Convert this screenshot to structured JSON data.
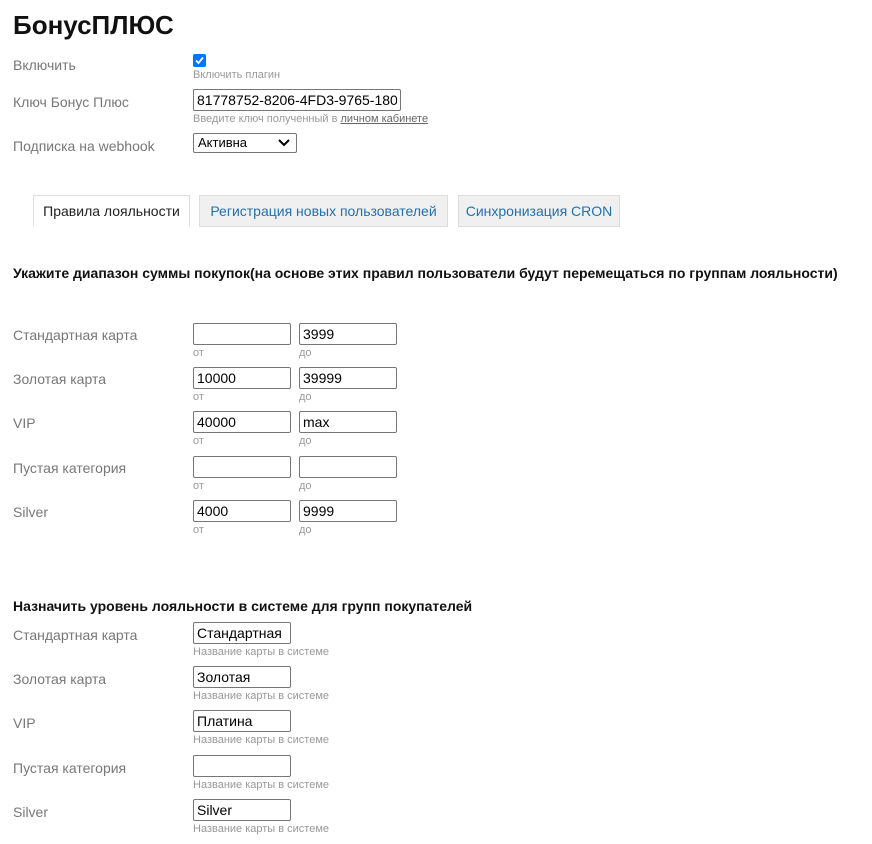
{
  "title": "БонусПЛЮС",
  "settings": {
    "enable_label": "Включить",
    "enable_hint": "Включить плагин",
    "enable_checked": true,
    "key_label": "Ключ Бонус Плюс",
    "key_value": "81778752-8206-4FD3-9765-180",
    "key_hint": "Введите ключ полученный в",
    "key_hint_link": "личном кабинете",
    "webhook_label": "Подписка на webhook",
    "webhook_value": "Активна"
  },
  "tabs": [
    {
      "label": "Правила лояльности",
      "active": true
    },
    {
      "label": "Регистрация новых пользователей",
      "active": false
    },
    {
      "label": "Синхронизация CRON",
      "active": false
    }
  ],
  "ranges": {
    "heading": "Укажите диапазон суммы покупок(на основе этих правил пользователи будут перемещаться по группам лояльности)",
    "from_hint": "от",
    "to_hint": "до",
    "rows": [
      {
        "label": "Стандартная карта",
        "from": "",
        "to": "3999"
      },
      {
        "label": "Золотая карта",
        "from": "10000",
        "to": "39999"
      },
      {
        "label": "VIP",
        "from": "40000",
        "to": "max"
      },
      {
        "label": "Пустая категория",
        "from": "",
        "to": ""
      },
      {
        "label": "Silver",
        "from": "4000",
        "to": "9999"
      }
    ]
  },
  "levels": {
    "heading": "Назначить уровень лояльности в системе для групп покупателей",
    "hint": "Название карты в системе",
    "rows": [
      {
        "label": "Стандартная карта",
        "value": "Стандартная"
      },
      {
        "label": "Золотая карта",
        "value": "Золотая"
      },
      {
        "label": "VIP",
        "value": "Платина"
      },
      {
        "label": "Пустая категория",
        "value": ""
      },
      {
        "label": "Silver",
        "value": "Silver"
      }
    ]
  }
}
